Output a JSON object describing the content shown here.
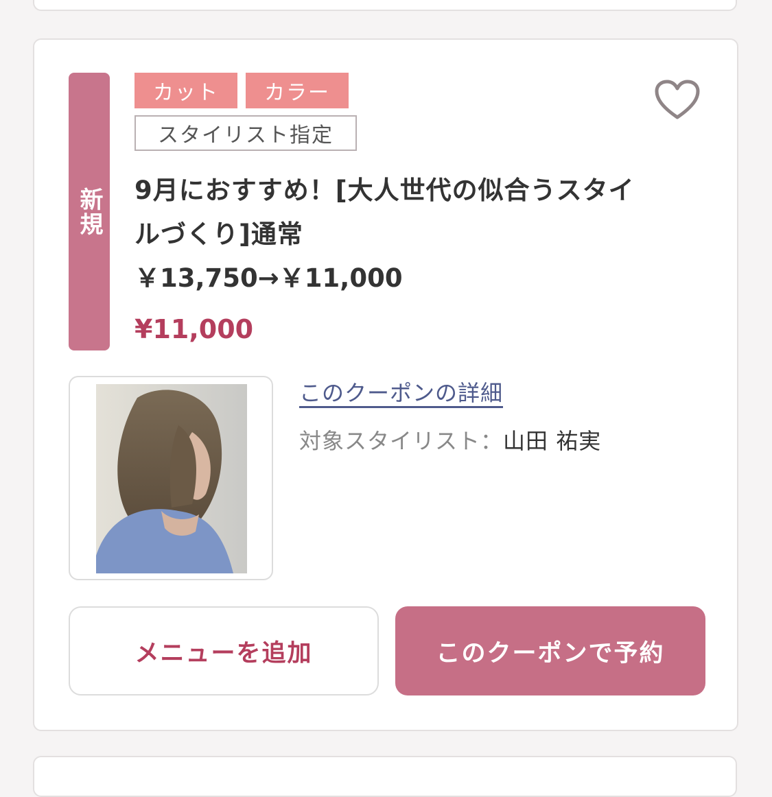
{
  "coupon": {
    "new_badge": "新規",
    "tags": [
      "カット",
      "カラー"
    ],
    "designation_tag": "スタイリスト指定",
    "title": "9月におすすめ！[大人世代の似合うスタイルづくり]通常",
    "price_line": "￥13,750→￥11,000",
    "price": "¥11,000",
    "detail_link": "このクーポンの詳細",
    "stylist_label": "対象スタイリスト：",
    "stylist_name": "山田 祐実",
    "add_menu_button": "メニューを追加",
    "reserve_button": "このクーポンで予約",
    "icons": {
      "favorite": "heart-outline-icon"
    }
  },
  "colors": {
    "accent": "#c66f86",
    "price": "#b43e5d",
    "tag_fill": "#ee8f8f",
    "link": "#4e5a8c"
  }
}
